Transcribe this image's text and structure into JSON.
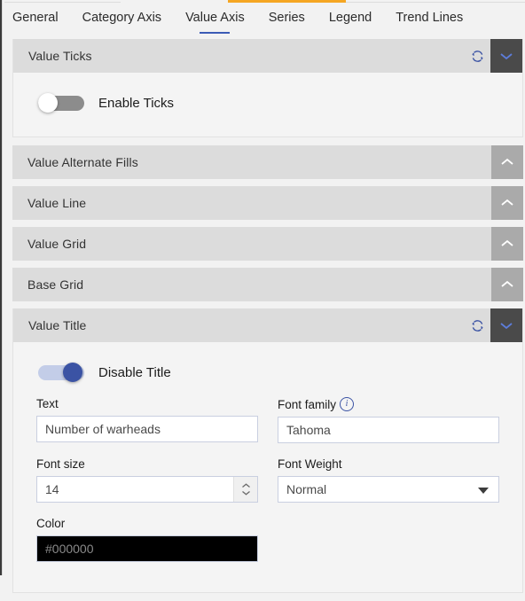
{
  "theme": {
    "accent_orange": "#f5a623",
    "accent_blue": "#3b53a4",
    "header_gray": "#dcdcdc",
    "dark_button": "#4a4a4a",
    "gray_button": "#aaaaaa"
  },
  "tabs": [
    {
      "label": "General",
      "active": false
    },
    {
      "label": "Category Axis",
      "active": false
    },
    {
      "label": "Value Axis",
      "active": true
    },
    {
      "label": "Series",
      "active": false
    },
    {
      "label": "Legend",
      "active": false
    },
    {
      "label": "Trend Lines",
      "active": false
    }
  ],
  "sections": [
    {
      "title": "Value Ticks",
      "expanded": true,
      "has_refresh": true,
      "chevron": "chevron-down-icon",
      "toggle": {
        "label": "Enable Ticks",
        "on": false
      }
    },
    {
      "title": "Value Alternate Fills",
      "expanded": false,
      "has_refresh": false,
      "chevron": "chevron-up-icon"
    },
    {
      "title": "Value Line",
      "expanded": false,
      "has_refresh": false,
      "chevron": "chevron-up-icon"
    },
    {
      "title": "Value Grid",
      "expanded": false,
      "has_refresh": false,
      "chevron": "chevron-up-icon"
    },
    {
      "title": "Base Grid",
      "expanded": false,
      "has_refresh": false,
      "chevron": "chevron-up-icon"
    },
    {
      "title": "Value Title",
      "expanded": true,
      "has_refresh": true,
      "chevron": "chevron-down-icon",
      "toggle": {
        "label": "Disable Title",
        "on": true
      }
    }
  ],
  "value_title_form": {
    "text": {
      "label": "Text",
      "value": "Number of warheads"
    },
    "font_family": {
      "label": "Font family",
      "value": "Tahoma",
      "info_icon": "info-circle-icon"
    },
    "font_size": {
      "label": "Font size",
      "value": "14"
    },
    "font_weight": {
      "label": "Font Weight",
      "value": "Normal",
      "options": [
        "Normal"
      ]
    },
    "color": {
      "label": "Color",
      "value": "#000000",
      "swatch": "#000000"
    }
  },
  "icons": {
    "refresh": "refresh-reset-icon",
    "chevron_down": "chevron-down-icon",
    "chevron_up": "chevron-up-icon",
    "spinner_up": "spinner-up-icon",
    "spinner_down": "spinner-down-icon",
    "select_arrow": "chevron-down-solid-icon"
  }
}
